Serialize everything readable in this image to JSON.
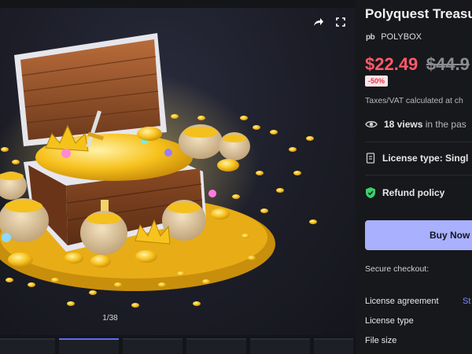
{
  "viewer": {
    "counter": "1/38",
    "thumb_count": 6,
    "share_icon": "share-arrow-icon",
    "fullscreen_icon": "fullscreen-icon"
  },
  "product": {
    "title": "Polyquest Treasu",
    "brand_logo": "pb",
    "brand_name": "POLYBOX",
    "price_now": "$22.49",
    "price_old": "$44.9",
    "discount": "-50%",
    "tax_note": "Taxes/VAT calculated at ch",
    "views_count": "18 views",
    "views_suffix": "in the pas",
    "license_label": "License type: Singl",
    "refund_label": "Refund policy",
    "buy_label": "Buy Now",
    "secure_label": "Secure checkout:",
    "license_agreement_label": "License agreement",
    "license_agreement_link": "St",
    "license_type_label": "License type",
    "file_size_label": "File size"
  },
  "colors": {
    "price": "#ff5a6a",
    "buy_button": "#a9b1ff",
    "refund_icon": "#3ecf6b",
    "link": "#7d8cff"
  }
}
